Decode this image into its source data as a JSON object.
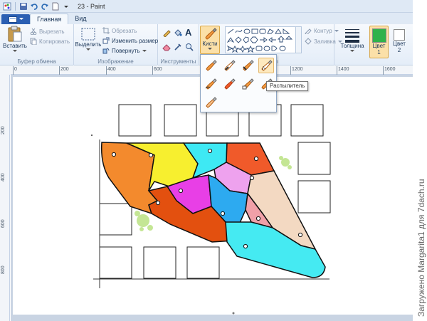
{
  "title": {
    "document": "23 - Paint"
  },
  "tabs": [
    {
      "label": "Главная",
      "active": true
    },
    {
      "label": "Вид",
      "active": false
    }
  ],
  "clipboard": {
    "paste": "Вставить",
    "cut": "Вырезать",
    "copy": "Копировать",
    "group": "Буфер обмена"
  },
  "image": {
    "select": "Выделить",
    "crop": "Обрезать",
    "resize": "Изменить размер",
    "rotate": "Повернуть",
    "group": "Изображение"
  },
  "tools": {
    "group": "Инструменты"
  },
  "brushes": {
    "label": "Кисти",
    "tooltip": "Распылитель"
  },
  "shapes": {
    "group_partial": "гуры",
    "outline": "Контур",
    "fill": "Заливка"
  },
  "size": {
    "label": "Толщина"
  },
  "colors": {
    "color1_a": "Цвет",
    "color1_b": "1",
    "color2_a": "Цвет",
    "color2_b": "2",
    "color1_value": "#2fb24b",
    "color2_value": "#ffffff"
  },
  "ruler": {
    "h_ticks": [
      "0",
      "200",
      "400",
      "600",
      "1200",
      "1400",
      "1600"
    ],
    "v_ticks": [
      "200",
      "400",
      "600",
      "800"
    ]
  },
  "watermark": "Загружено Margarita1 для 7dach.ru",
  "accent": {
    "file_button": "#2b5fb3",
    "hover": "#fde9bf"
  }
}
